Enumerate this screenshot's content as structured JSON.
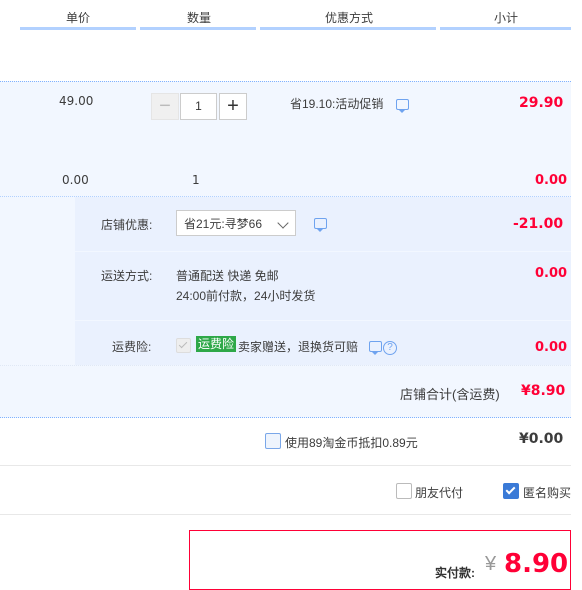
{
  "header": {
    "unit_price": "单价",
    "quantity": "数量",
    "discount_method": "优惠方式",
    "subtotal": "小计"
  },
  "item1": {
    "price": "49.00",
    "quantity": "1",
    "promo": "省19.10:活动促销",
    "subtotal": "29.90",
    "minus": "−",
    "plus": "+"
  },
  "item2": {
    "price": "0.00",
    "quantity": "1",
    "subtotal": "0.00"
  },
  "shop_discount": {
    "label": "店铺优惠:",
    "selected": "省21元:寻梦66",
    "amount": "-21.00"
  },
  "shipping": {
    "label": "运送方式:",
    "method": "普通配送 快递 免邮",
    "note": "24:00前付款，24小时发货",
    "amount": "0.00"
  },
  "insurance": {
    "label": "运费险:",
    "badge": "运费险",
    "text": "卖家赠送，退换货可赔",
    "help": "?",
    "amount": "0.00"
  },
  "shop_total": {
    "label": "店铺合计(含运费)",
    "amount": "¥8.90"
  },
  "coins": {
    "label": "使用89淘金币抵扣0.89元",
    "amount": "¥0.00"
  },
  "options": {
    "friend_pay": "朋友代付",
    "anonymous": "匿名购买",
    "anonymous_checked": true
  },
  "payment": {
    "label": "实付款:",
    "currency": "¥",
    "amount": "8.90"
  },
  "colors": {
    "accent_red": "#ff0036",
    "accent_blue": "#3a7ad7",
    "badge_green": "#2ea848",
    "panel_bg": "#f2f7ff"
  }
}
